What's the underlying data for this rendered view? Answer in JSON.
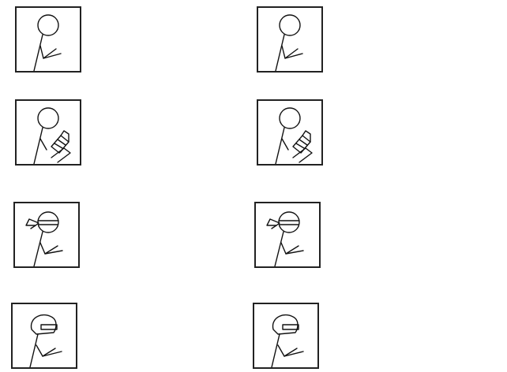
{
  "canvas": {
    "background": "#ffffff"
  },
  "tiles": [
    {
      "figure": "plain",
      "icon": "stick-figure-icon"
    },
    {
      "figure": "plain",
      "icon": "stick-figure-icon"
    },
    {
      "figure": "holding-item",
      "icon": "stick-figure-holding-item-icon"
    },
    {
      "figure": "holding-item",
      "icon": "stick-figure-holding-item-icon"
    },
    {
      "figure": "headband",
      "icon": "stick-figure-headband-icon"
    },
    {
      "figure": "headband",
      "icon": "stick-figure-headband-icon"
    },
    {
      "figure": "helmet",
      "icon": "stick-figure-helmet-icon"
    },
    {
      "figure": "helmet",
      "icon": "stick-figure-helmet-icon"
    }
  ],
  "colors": {
    "line": "#111111",
    "border": "#222222"
  }
}
